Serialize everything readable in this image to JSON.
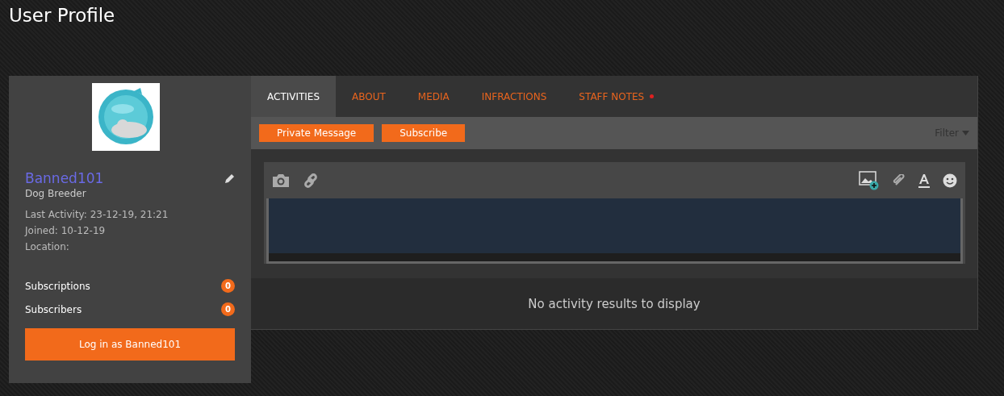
{
  "page_title": "User Profile",
  "profile": {
    "name": "Banned101",
    "role": "Dog Breeder",
    "details": [
      "Last Activity: 23-12-19, 21:21",
      "Joined: 10-12-19",
      "Location:"
    ],
    "counts": [
      {
        "label": "Subscriptions",
        "count": "0"
      },
      {
        "label": "Subscribers",
        "count": "0"
      }
    ],
    "login_button": "Log in as Banned101"
  },
  "tabs": [
    {
      "label": "ACTIVITIES",
      "selected": true,
      "dot": false
    },
    {
      "label": "ABOUT",
      "selected": false,
      "dot": false
    },
    {
      "label": "MEDIA",
      "selected": false,
      "dot": false
    },
    {
      "label": "INFRACTIONS",
      "selected": false,
      "dot": false
    },
    {
      "label": "STAFF NOTES",
      "selected": false,
      "dot": true
    }
  ],
  "actions": [
    "Private Message",
    "Subscribe"
  ],
  "filter": "Filter",
  "empty_message": "No activity results to display"
}
